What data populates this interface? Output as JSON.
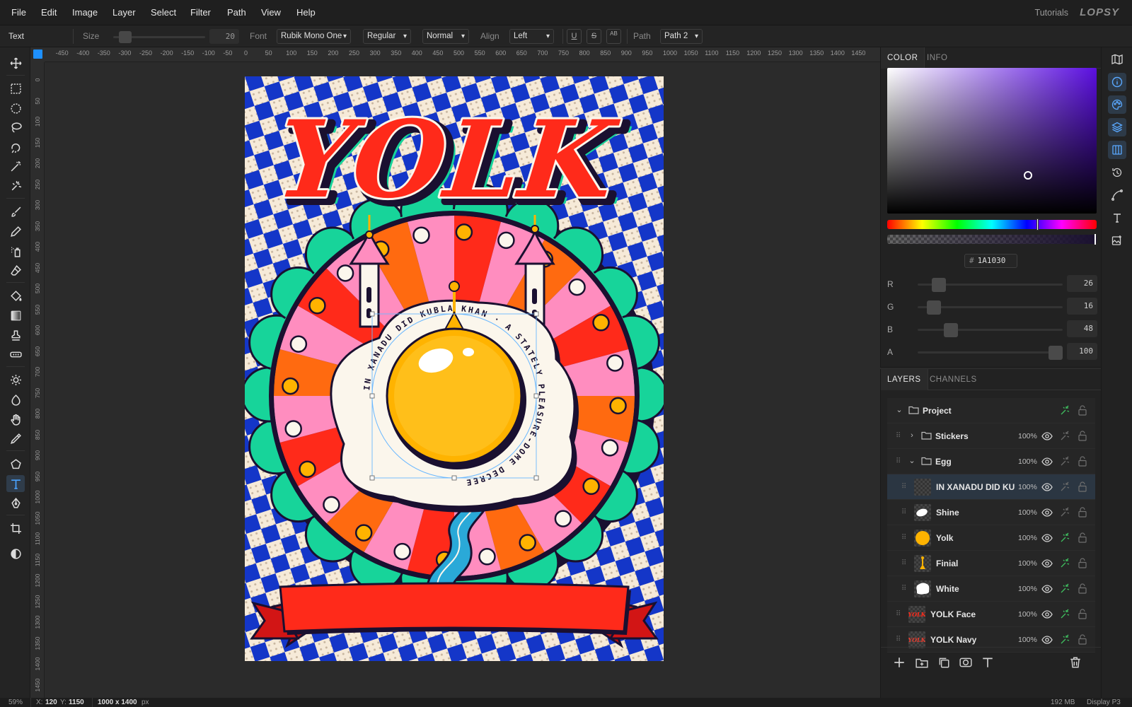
{
  "menu": {
    "items": [
      "File",
      "Edit",
      "Image",
      "Layer",
      "Select",
      "Filter",
      "Path",
      "View",
      "Help"
    ],
    "tutorials": "Tutorials",
    "logo": "LOPSY"
  },
  "options": {
    "tool_name": "Text",
    "size_label": "Size",
    "size_value": "20",
    "font_label": "Font",
    "font_value": "Rubik Mono One",
    "weight_value": "Regular",
    "blend_value": "Normal",
    "align_label": "Align",
    "align_value": "Left",
    "underline": "U",
    "strike": "S",
    "case": "AB",
    "path_label": "Path",
    "path_value": "Path 2"
  },
  "tools": [
    "move-icon",
    "rect-select-icon",
    "ellipse-select-icon",
    "lasso-icon",
    "magnetic-lasso-icon",
    "magic-wand-icon",
    "quick-select-icon",
    "brush-icon",
    "pencil-icon",
    "spray-icon",
    "eraser-icon",
    "fill-icon",
    "gradient-icon",
    "stamp-icon",
    "heal-icon",
    "dodge-icon",
    "burn-icon",
    "hand-icon",
    "eyedropper-icon",
    "shape-icon",
    "text-icon",
    "pen-icon",
    "crop-icon",
    "contrast-icon"
  ],
  "ruler": {
    "top": [
      "-450",
      "-400",
      "-350",
      "-300",
      "-250",
      "-200",
      "-150",
      "-100",
      "-50",
      "0",
      "50",
      "100",
      "150",
      "200",
      "250",
      "300",
      "350",
      "400",
      "450",
      "500",
      "550",
      "600",
      "650",
      "700",
      "750",
      "800",
      "850",
      "900",
      "950",
      "1000",
      "1050",
      "1100",
      "1150",
      "1200",
      "1250",
      "1300",
      "1350",
      "1400",
      "1450"
    ],
    "left": [
      "0",
      "50",
      "100",
      "150",
      "200",
      "250",
      "300",
      "350",
      "400",
      "450",
      "500",
      "550",
      "600",
      "650",
      "700",
      "750",
      "800",
      "850",
      "900",
      "950",
      "1000",
      "1050",
      "1100",
      "1150",
      "1200",
      "1250",
      "1300",
      "1350",
      "1400",
      "1450"
    ]
  },
  "artwork": {
    "title": "YOLK",
    "curved_text": "IN XANADU DID KUBLA KHAN  ·  A STATELY PLEASURE-DOME DECREE",
    "colors": {
      "red": "#ff2a1a",
      "pink": "#ff8dbf",
      "orange": "#ff6a10",
      "mint": "#17d49a",
      "navy": "#1a1030",
      "blue": "#1436c8",
      "cream": "#fbf6ec",
      "yolk": "#ffb300"
    }
  },
  "color_panel": {
    "tabs": [
      "COLOR",
      "INFO"
    ],
    "hex": "1A1030",
    "hex_prefix": "#",
    "channels": [
      {
        "label": "R",
        "value": "26",
        "level": 0.1
      },
      {
        "label": "G",
        "value": "16",
        "level": 0.063
      },
      {
        "label": "B",
        "value": "48",
        "level": 0.19
      },
      {
        "label": "A",
        "value": "100",
        "level": 1.0
      }
    ]
  },
  "layers_panel": {
    "tabs": [
      "LAYERS",
      "CHANNELS"
    ],
    "rows": [
      {
        "name": "Project",
        "opacity": ""
      },
      {
        "name": "Stickers",
        "opacity": "100%"
      },
      {
        "name": "Egg",
        "opacity": "100%"
      },
      {
        "name": "IN XANADU DID KU",
        "opacity": "100%"
      },
      {
        "name": "Shine",
        "opacity": "100%"
      },
      {
        "name": "Yolk",
        "opacity": "100%"
      },
      {
        "name": "Finial",
        "opacity": "100%"
      },
      {
        "name": "White",
        "opacity": "100%"
      },
      {
        "name": "YOLK Face",
        "opacity": "100%"
      },
      {
        "name": "YOLK Navy",
        "opacity": "100%"
      }
    ]
  },
  "status": {
    "zoom": "59%",
    "x_label": "X:",
    "x": "120",
    "y_label": "Y:",
    "y": "1150",
    "doc_size": "1000 x 1400",
    "doc_unit": "px",
    "memory": "192 MB",
    "profile": "Display P3"
  }
}
